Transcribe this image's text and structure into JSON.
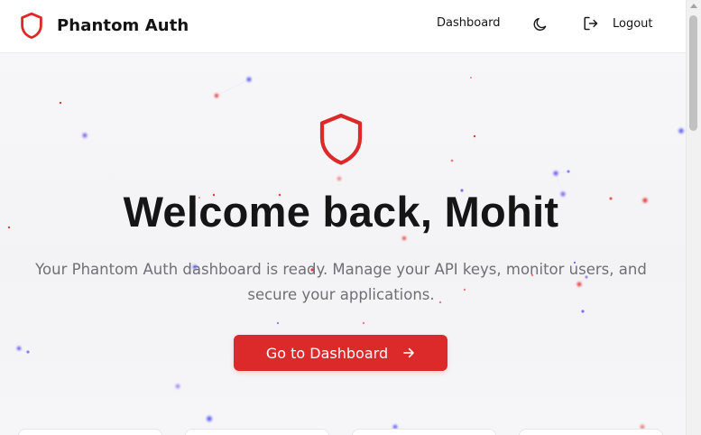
{
  "header": {
    "brand_name": "Phantom Auth",
    "brand_icon": "shield-icon",
    "nav_dashboard": "Dashboard",
    "theme_icon": "moon-icon",
    "logout_icon": "logout-icon",
    "logout_label": "Logout"
  },
  "hero": {
    "icon": "shield-icon",
    "title": "Welcome back, Mohit",
    "subtitle": "Your Phantom Auth dashboard is ready. Manage your API keys, monitor users, and secure your applications.",
    "cta_label": "Go to Dashboard",
    "cta_icon": "arrow-right-icon"
  },
  "colors": {
    "brand_red": "#dc2a2a",
    "text_dark": "#151515",
    "text_muted": "#6f6f76",
    "particle_red": "#e23b3b",
    "particle_violet": "#8b6cf0",
    "particle_blue": "#6a6af0"
  }
}
